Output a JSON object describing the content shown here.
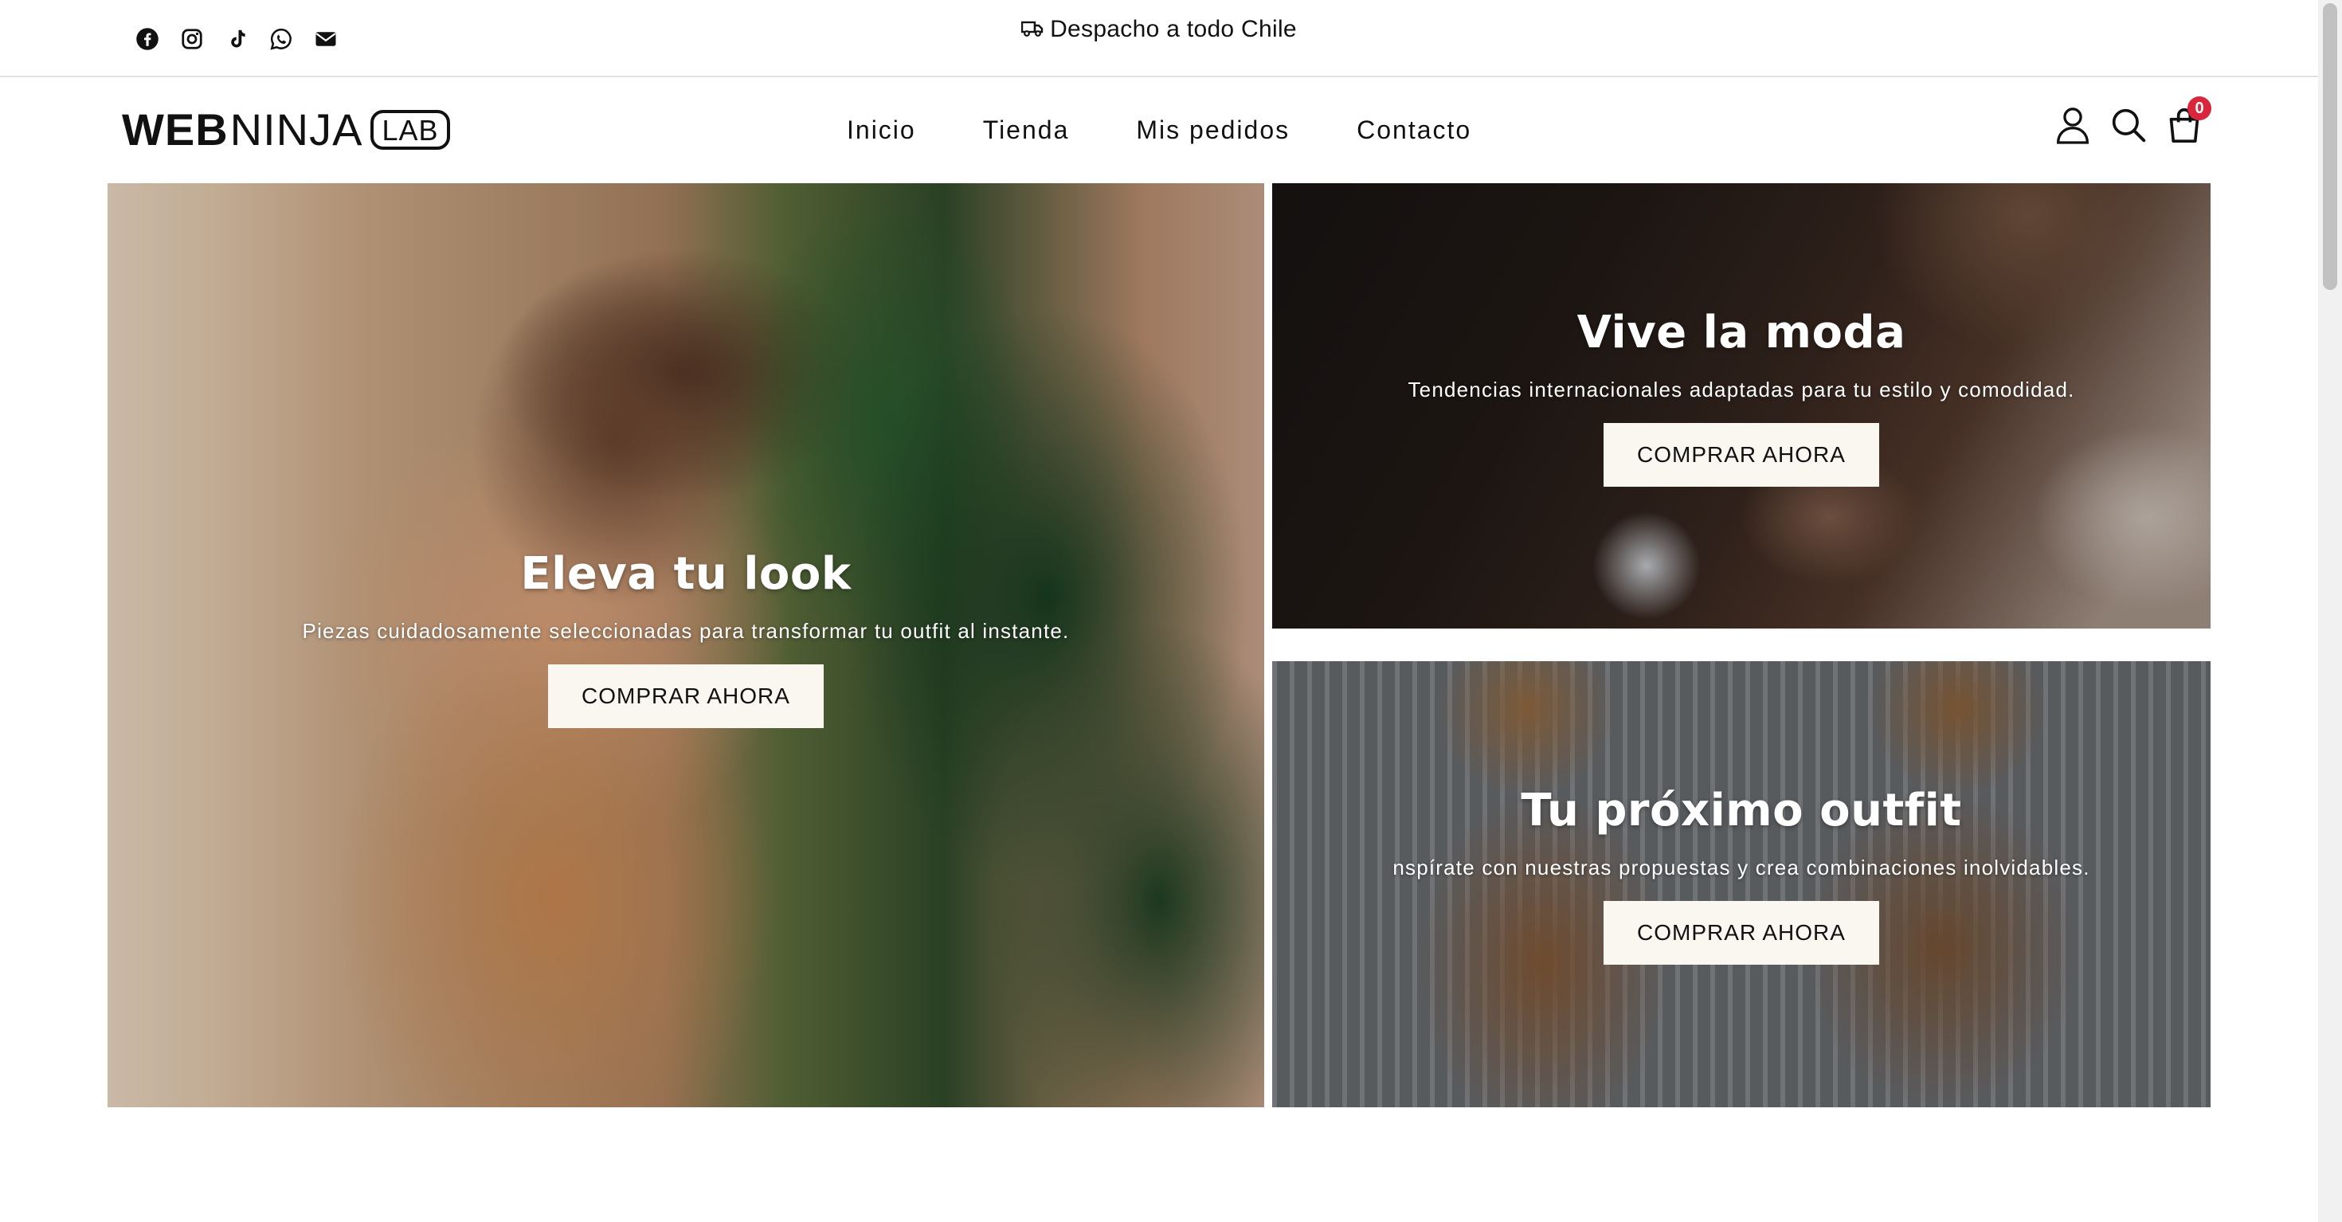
{
  "topbar": {
    "socials": [
      "facebook-icon",
      "instagram-icon",
      "tiktok-icon",
      "whatsapp-icon",
      "email-icon"
    ],
    "shipping_text": "Despacho a todo Chile"
  },
  "header": {
    "logo": {
      "part1": "WEB",
      "part2": "NINJA",
      "part3": "LAB"
    },
    "nav": [
      "Inicio",
      "Tienda",
      "Mis pedidos",
      "Contacto"
    ],
    "cart_count": "0"
  },
  "banners": [
    {
      "title": "Eleva tu look",
      "subtitle": "Piezas cuidadosamente seleccionadas para transformar tu outfit al instante.",
      "button": "COMPRAR AHORA"
    },
    {
      "title": "Vive la moda",
      "subtitle": "Tendencias internacionales adaptadas para tu estilo y comodidad.",
      "button": "COMPRAR AHORA"
    },
    {
      "title": "Tu próximo outfit",
      "subtitle": "nspírate con nuestras propuestas y crea combinaciones inolvidables.",
      "button": "COMPRAR AHORA"
    }
  ],
  "colors": {
    "accent": "#d9263c",
    "button_bg": "#faf7f1",
    "text": "#111111"
  }
}
